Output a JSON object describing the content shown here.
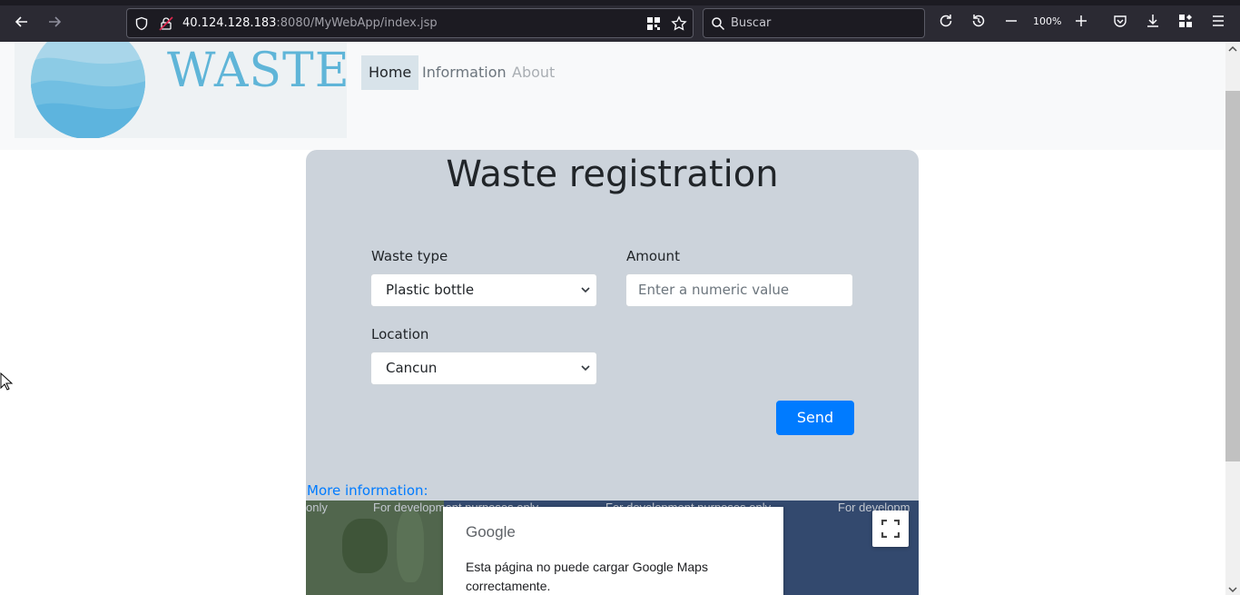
{
  "browser": {
    "url_host": "40.124.128.183",
    "url_rest": ":8080/MyWebApp/index.jsp",
    "search_placeholder": "Buscar",
    "zoom": "100%"
  },
  "navbar": {
    "logo_text": "WASTE",
    "items": [
      {
        "label": "Home",
        "active": true
      },
      {
        "label": "Information"
      },
      {
        "label": "About",
        "disabled": true
      }
    ]
  },
  "form": {
    "title": "Waste registration",
    "waste_type_label": "Waste type",
    "waste_type_value": "Plastic bottle",
    "amount_label": "Amount",
    "amount_placeholder": "Enter a numeric value",
    "location_label": "Location",
    "location_value": "Cancun",
    "send_label": "Send"
  },
  "more_info": "More information:",
  "map": {
    "dev_watermark": "For development purposes only",
    "dev_fragment": "only",
    "dev_fragment2": "For developm",
    "google_logo": "Google",
    "error_message": "Esta página no puede cargar Google Maps correctamente."
  },
  "colors": {
    "accent": "#007bff",
    "card_bg": "#ccd3db",
    "logo_blue": "#5fb5d8"
  }
}
